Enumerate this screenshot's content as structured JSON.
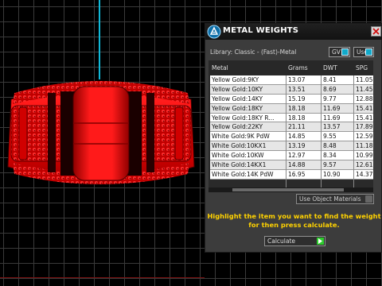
{
  "panel": {
    "title": "METAL WEIGHTS",
    "library_label": "Library: Classic - (Fast)-Metal",
    "gv_label": "GV",
    "user_label": "User",
    "columns": [
      "Metal",
      "Grams",
      "DWT",
      "SPG"
    ],
    "rows": [
      {
        "metal": "Yellow Gold:9KY",
        "grams": "13.07",
        "dwt": "8.41",
        "spg": "11.05"
      },
      {
        "metal": "Yellow Gold:10KY",
        "grams": "13.51",
        "dwt": "8.69",
        "spg": "11.45"
      },
      {
        "metal": "Yellow Gold:14KY",
        "grams": "15.19",
        "dwt": "9.77",
        "spg": "12.88"
      },
      {
        "metal": "Yellow Gold:18KY",
        "grams": "18.18",
        "dwt": "11.69",
        "spg": "15.41"
      },
      {
        "metal": "Yellow Gold:18KY R...",
        "grams": "18.18",
        "dwt": "11.69",
        "spg": "15.41"
      },
      {
        "metal": "Yellow Gold:22KY",
        "grams": "21.11",
        "dwt": "13.57",
        "spg": "17.89"
      },
      {
        "metal": "White Gold:9K PdW",
        "grams": "14.85",
        "dwt": "9.55",
        "spg": "12.59"
      },
      {
        "metal": "White Gold:10KX1",
        "grams": "13.19",
        "dwt": "8.48",
        "spg": "11.18"
      },
      {
        "metal": "White Gold:10KW",
        "grams": "12.97",
        "dwt": "8.34",
        "spg": "10.99"
      },
      {
        "metal": "White Gold:14KX1",
        "grams": "14.88",
        "dwt": "9.57",
        "spg": "12.61"
      },
      {
        "metal": "White Gold:14K PdW",
        "grams": "16.95",
        "dwt": "10.90",
        "spg": "14.37"
      }
    ],
    "materials_option": "Use Object Materials",
    "instruction_line1": "Highlight the item you want to find the weight",
    "instruction_line2": "for then press calculate.",
    "calculate_label": "Calculate"
  },
  "colors": {
    "accent": "#11a9c9",
    "instruction": "#ffd200",
    "model": "#ff0000",
    "calculate_go": "#2ecc2e"
  },
  "icons": {
    "title": "gem-icon",
    "close": "close-icon",
    "calculate": "play-icon"
  }
}
